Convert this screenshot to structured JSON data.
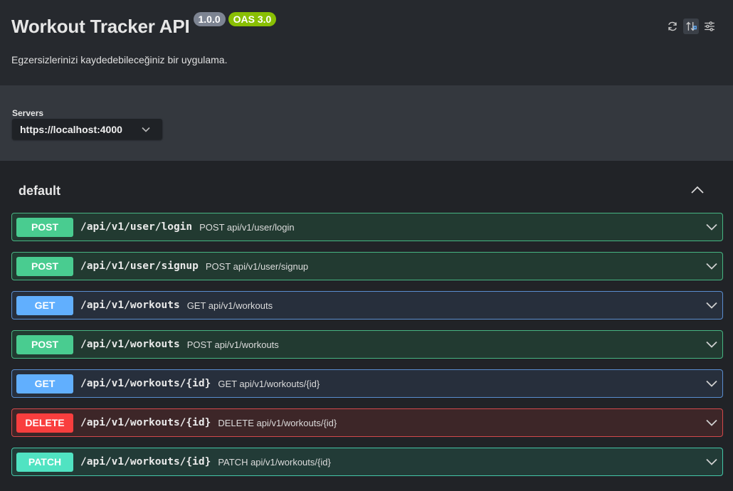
{
  "info": {
    "title": "Workout Tracker API",
    "version_badge": "1.0.0",
    "oas_badge": "OAS 3.0",
    "description": "Egzersizlerinizi kaydedebileceğiniz bir uygulama."
  },
  "toolbar": {
    "icons": [
      "refresh-icon",
      "sort-icon",
      "settings-sliders-icon"
    ]
  },
  "servers": {
    "label": "Servers",
    "selected": "https://localhost:4000"
  },
  "tag": {
    "name": "default"
  },
  "operations": [
    {
      "method": "POST",
      "path": "/api/v1/user/login",
      "summary": "POST api/v1/user/login"
    },
    {
      "method": "POST",
      "path": "/api/v1/user/signup",
      "summary": "POST api/v1/user/signup"
    },
    {
      "method": "GET",
      "path": "/api/v1/workouts",
      "summary": "GET api/v1/workouts"
    },
    {
      "method": "POST",
      "path": "/api/v1/workouts",
      "summary": "POST api/v1/workouts"
    },
    {
      "method": "GET",
      "path": "/api/v1/workouts/{id}",
      "summary": "GET api/v1/workouts/{id}"
    },
    {
      "method": "DELETE",
      "path": "/api/v1/workouts/{id}",
      "summary": "DELETE api/v1/workouts/{id}"
    },
    {
      "method": "PATCH",
      "path": "/api/v1/workouts/{id}",
      "summary": "PATCH api/v1/workouts/{id}"
    }
  ],
  "colors": {
    "post": "#49cc90",
    "get": "#61affe",
    "delete": "#f93e3e",
    "patch": "#50e3c2",
    "oas_badge": "#89bf04",
    "version_badge": "#7d8492"
  }
}
